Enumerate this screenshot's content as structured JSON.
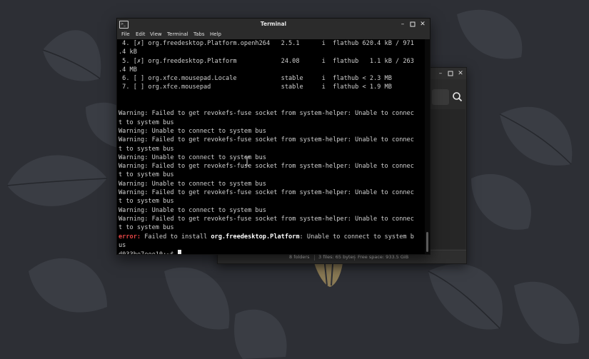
{
  "terminal": {
    "title": "Terminal",
    "menu": [
      "File",
      "Edit",
      "View",
      "Terminal",
      "Tabs",
      "Help"
    ],
    "lines": [
      [
        {
          "t": " 4. [✗] org.freedesktop.Platform.openh264   2.5.1      i  flathub 620.4 kB / 971"
        }
      ],
      [
        {
          "t": ".4 kB"
        }
      ],
      [
        {
          "t": " 5. [✗] org.freedesktop.Platform            24.08      i  flathub   1.1 kB / 263"
        }
      ],
      [
        {
          "t": ".4 MB"
        }
      ],
      [
        {
          "t": " 6. [ ] org.xfce.mousepad.Locale            stable     i  flathub < 2.3 MB"
        }
      ],
      [
        {
          "t": " 7. [ ] org.xfce.mousepad                   stable     i  flathub < 1.9 MB"
        }
      ],
      [
        {
          "t": ""
        }
      ],
      [
        {
          "t": ""
        }
      ],
      [
        {
          "t": "Warning: Failed to get revokefs-fuse socket from system-helper: Unable to connec"
        }
      ],
      [
        {
          "t": "t to system bus"
        }
      ],
      [
        {
          "t": "Warning: Unable to connect to system bus"
        }
      ],
      [
        {
          "t": "Warning: Failed to get revokefs-fuse socket from system-helper: Unable to connec"
        }
      ],
      [
        {
          "t": "t to system bus"
        }
      ],
      [
        {
          "t": "Warning: Unable to connect to system bus"
        }
      ],
      [
        {
          "t": "Warning: Failed to get revokefs-fuse socket from system-helper: Unable to connec"
        }
      ],
      [
        {
          "t": "t to system bus"
        }
      ],
      [
        {
          "t": "Warning: Unable to connect to system bus"
        }
      ],
      [
        {
          "t": "Warning: Failed to get revokefs-fuse socket from system-helper: Unable to connec"
        }
      ],
      [
        {
          "t": "t to system bus"
        }
      ],
      [
        {
          "t": "Warning: Unable to connect to system bus"
        }
      ],
      [
        {
          "t": "Warning: Failed to get revokefs-fuse socket from system-helper: Unable to connec"
        }
      ],
      [
        {
          "t": "t to system bus"
        }
      ],
      [
        {
          "t": "error:",
          "s": "err"
        },
        {
          "t": " Failed to install "
        },
        {
          "t": "org.freedesktop.Platform",
          "s": "bold"
        },
        {
          "t": ": Unable to connect to system b"
        }
      ],
      [
        {
          "t": "us"
        }
      ]
    ],
    "prompt": "d033be7eee10:~$ "
  },
  "file_manager": {
    "status": [
      "8 folders",
      "3 files: 65 bytes",
      "Free space: 933.5 GiB"
    ]
  },
  "colors": {
    "error": "#e04444",
    "terminal_bg": "#000000",
    "desktop_bg": "#2d2f35"
  },
  "icons": [
    "terminal-app-icon",
    "minimize-icon",
    "maximize-icon",
    "close-icon",
    "search-icon",
    "text-cursor-icon"
  ]
}
